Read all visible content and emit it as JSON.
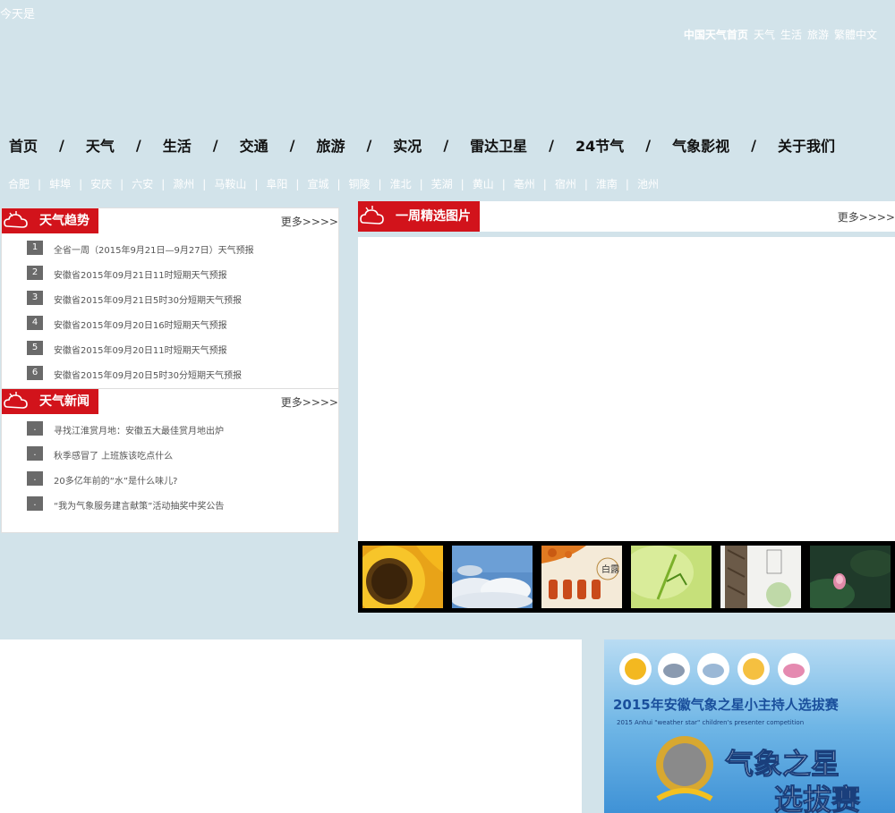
{
  "header": {
    "today_label": "今天是",
    "top_links": [
      "中国天气首页",
      "天气",
      "生活",
      "旅游",
      "繁體中文"
    ]
  },
  "main_nav": [
    "首页",
    "天气",
    "生活",
    "交通",
    "旅游",
    "实况",
    "雷达卫星",
    "24节气",
    "气象影视",
    "关于我们"
  ],
  "city_nav": [
    "合肥",
    "蚌埠",
    "安庆",
    "六安",
    "滁州",
    "马鞍山",
    "阜阳",
    "宣城",
    "铜陵",
    "淮北",
    "芜湖",
    "黄山",
    "亳州",
    "宿州",
    "淮南",
    "池州"
  ],
  "trend": {
    "title": "天气趋势",
    "more": "更多>>>>",
    "items": [
      {
        "num": "1",
        "text": "全省一周（2015年9月21日—9月27日）天气预报"
      },
      {
        "num": "2",
        "text": "安徽省2015年09月21日11时短期天气预报"
      },
      {
        "num": "3",
        "text": "安徽省2015年09月21日5时30分短期天气预报"
      },
      {
        "num": "4",
        "text": "安徽省2015年09月20日16时短期天气预报"
      },
      {
        "num": "5",
        "text": "安徽省2015年09月20日11时短期天气预报"
      },
      {
        "num": "6",
        "text": "安徽省2015年09月20日5时30分短期天气预报"
      }
    ]
  },
  "news": {
    "title": "天气新闻",
    "more": "更多>>>>",
    "items": [
      {
        "num": ".",
        "text": "寻找江淮赏月地：安徽五大最佳赏月地出炉"
      },
      {
        "num": ".",
        "text": "秋季感冒了 上班族该吃点什么"
      },
      {
        "num": ".",
        "text": "20多亿年前的“水”是什么味儿?"
      },
      {
        "num": ".",
        "text": "“我为气象服务建言献策”活动抽奖中奖公告"
      }
    ]
  },
  "photos": {
    "title": "一周精选图片",
    "more": "更多>>>>",
    "thumbs": [
      "sunflower",
      "clouds",
      "autumn-lanterns",
      "mantis",
      "tree-bark",
      "lotus"
    ],
    "thumb_caption": "白露"
  },
  "banner": {
    "line1": "2015年安徽气象之星小主持人选拔赛",
    "line2": "2015 Anhui \"weather star\" children's presenter competition",
    "line3": "气象之星",
    "line4": "选拔赛"
  },
  "colors": {
    "background": "#d2e3ea",
    "accent_red": "#d2131b",
    "badge_gray": "#6a6a6a"
  }
}
